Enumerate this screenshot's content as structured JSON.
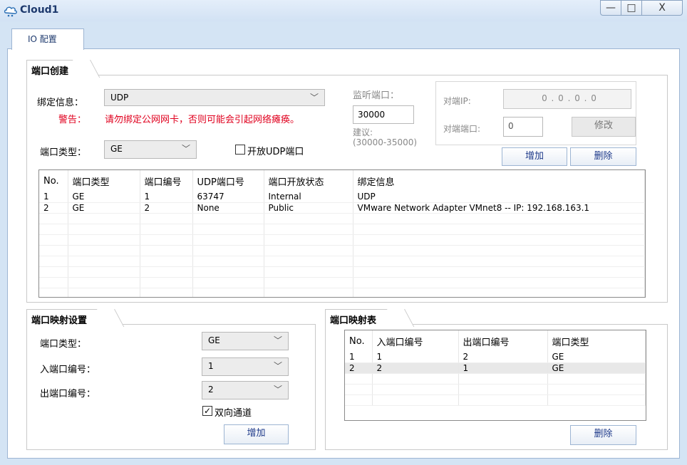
{
  "window": {
    "title": "Cloud1",
    "min_label": "—",
    "max_label": "□",
    "close_label": "X"
  },
  "tab": {
    "label": "IO 配置"
  },
  "port_create": {
    "title": "端口创建",
    "bind_label": "绑定信息：",
    "bind_value": "UDP",
    "warn_label": "警告：",
    "warn_text": "请勿绑定公网网卡，否则可能会引起网络瘫痪。",
    "listen_label": "监听端口：",
    "listen_value": "30000",
    "suggest_label": "建议:",
    "suggest_range": "(30000-35000)",
    "peer_ip_label": "对端IP:",
    "peer_ip_value": "0 . 0 . 0 . 0",
    "peer_port_label": "对端端口:",
    "peer_port_value": "0",
    "modify_label": "修改",
    "port_type_label": "端口类型：",
    "port_type_value": "GE",
    "open_udp_label": "开放UDP端口",
    "add_label": "增加",
    "delete_label": "删除",
    "table": {
      "headers": [
        "No.",
        "端口类型",
        "端口编号",
        "UDP端口号",
        "端口开放状态",
        "绑定信息"
      ],
      "rows": [
        [
          "1",
          "GE",
          "1",
          "63747",
          "Internal",
          "UDP"
        ],
        [
          "2",
          "GE",
          "2",
          "None",
          "Public",
          "VMware Network Adapter VMnet8 -- IP: 192.168.163.1"
        ]
      ]
    }
  },
  "mapping_settings": {
    "title": "端口映射设置",
    "type_label": "端口类型：",
    "type_value": "GE",
    "in_label": "入端口编号：",
    "in_value": "1",
    "out_label": "出端口编号：",
    "out_value": "2",
    "bidirectional_label": "双向通道",
    "add_label": "增加"
  },
  "mapping_table": {
    "title": "端口映射表",
    "headers": [
      "No.",
      "入端口编号",
      "出端口编号",
      "端口类型"
    ],
    "rows": [
      [
        "1",
        "1",
        "2",
        "GE"
      ],
      [
        "2",
        "2",
        "1",
        "GE"
      ]
    ],
    "delete_label": "删除"
  }
}
